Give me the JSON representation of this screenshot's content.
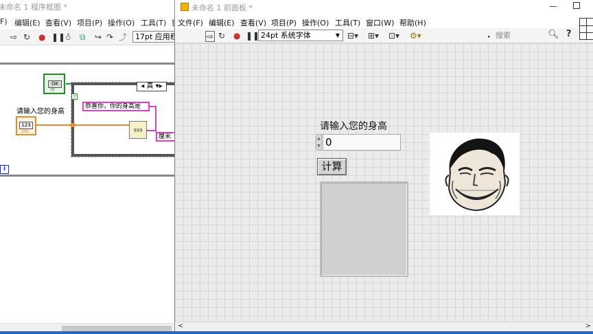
{
  "block_diagram": {
    "title": "未命名 1 程序框图 *",
    "menu": [
      "F)",
      "编辑(E)",
      "查看(V)",
      "项目(P)",
      "操作(O)",
      "工具(T)",
      "窗"
    ],
    "font_select": "17pt 应用程",
    "ok_button_label": "OK",
    "ok_terminal_text": "TF",
    "stop_terminal": "?",
    "numeric_control_label": "请输入您的身高",
    "numeric_terminal_text": "123",
    "numeric_terminal_type": "DBL",
    "case_selector": "真",
    "string_constant_1": "恭喜你，你的身高是",
    "string_constant_2": "厘米",
    "num_to_string_text": "999",
    "iteration_terminal": "i"
  },
  "front_panel": {
    "title": "未命名 1 前面板 *",
    "menu": [
      "文件(F)",
      "编辑(E)",
      "查看(V)",
      "项目(P)",
      "操作(O)",
      "工具(T)",
      "窗口(W)",
      "帮助(H)"
    ],
    "font_select": "24pt 系统字体",
    "search_placeholder": "搜索",
    "numeric_label": "请输入您的身高",
    "numeric_value": "0",
    "calc_button_label": "计算"
  },
  "icons": [
    "run-arrow-icon",
    "run-continuous-icon",
    "abort-icon",
    "pause-icon",
    "highlight-icon",
    "retain-wire-icon",
    "step-into-icon",
    "step-over-icon",
    "step-out-icon",
    "align-icon",
    "distribute-icon",
    "resize-icon",
    "reorder-icon",
    "search-icon",
    "help-icon",
    "connector-pane-icon"
  ],
  "colors": {
    "numeric_wire": "#f08a24",
    "string_wire": "#e040c0",
    "boolean": "#1e8f2b",
    "panel_grid": "#ebebeb"
  }
}
